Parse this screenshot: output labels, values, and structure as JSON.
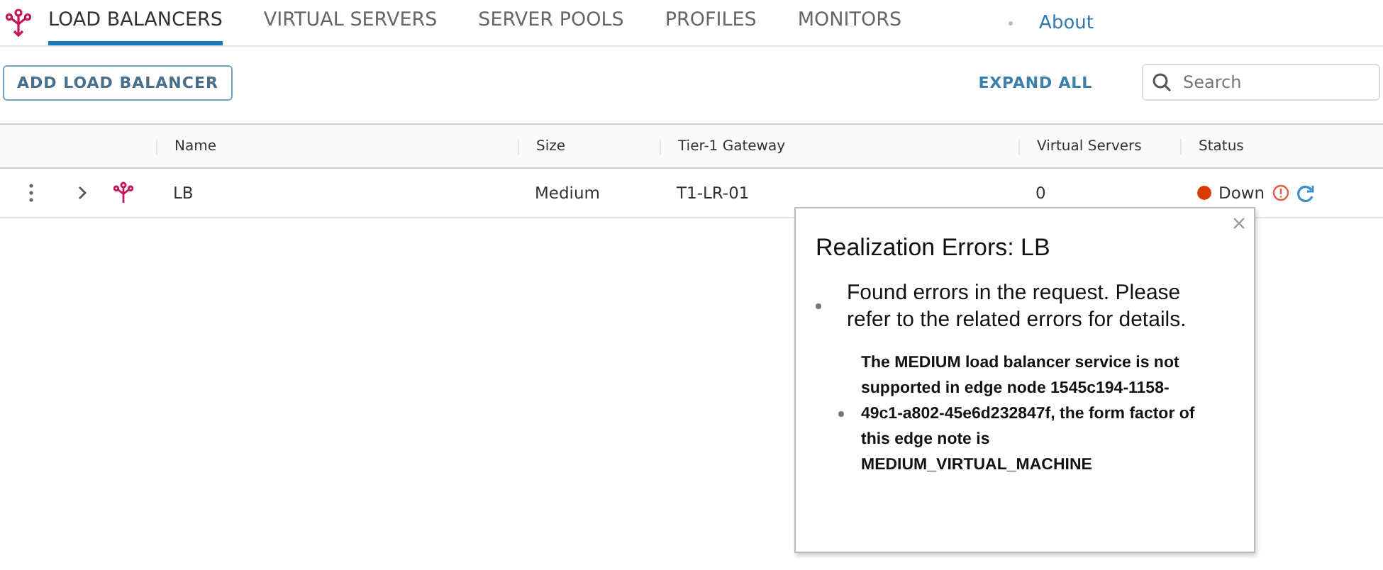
{
  "tabs": [
    {
      "label": "LOAD BALANCERS",
      "selected": true
    },
    {
      "label": "VIRTUAL SERVERS",
      "selected": false
    },
    {
      "label": "SERVER POOLS",
      "selected": false
    },
    {
      "label": "PROFILES",
      "selected": false
    },
    {
      "label": "MONITORS",
      "selected": false
    }
  ],
  "about_link": "About",
  "add_button": "ADD LOAD BALANCER",
  "expand_all": "EXPAND ALL",
  "search": {
    "placeholder": "Search"
  },
  "table": {
    "columns": [
      "Name",
      "Size",
      "Tier-1 Gateway",
      "Virtual Servers",
      "Status"
    ],
    "rows": [
      {
        "name": "LB",
        "size": "Medium",
        "gateway": "T1-LR-01",
        "virtual_servers": "0",
        "status": "Down",
        "color": "#d93a00",
        "expanded": false
      }
    ]
  },
  "popover": {
    "title": "Realization Errors: LB",
    "errors": [
      "Found errors in the request. Please refer to the related errors for details.",
      "The MEDIUM load balancer service is not supported in edge node 1545c194-1158-49c1-a802-45e6d232847f, the form factor of this edge note is MEDIUM_VIRTUAL_MACHINE"
    ]
  }
}
